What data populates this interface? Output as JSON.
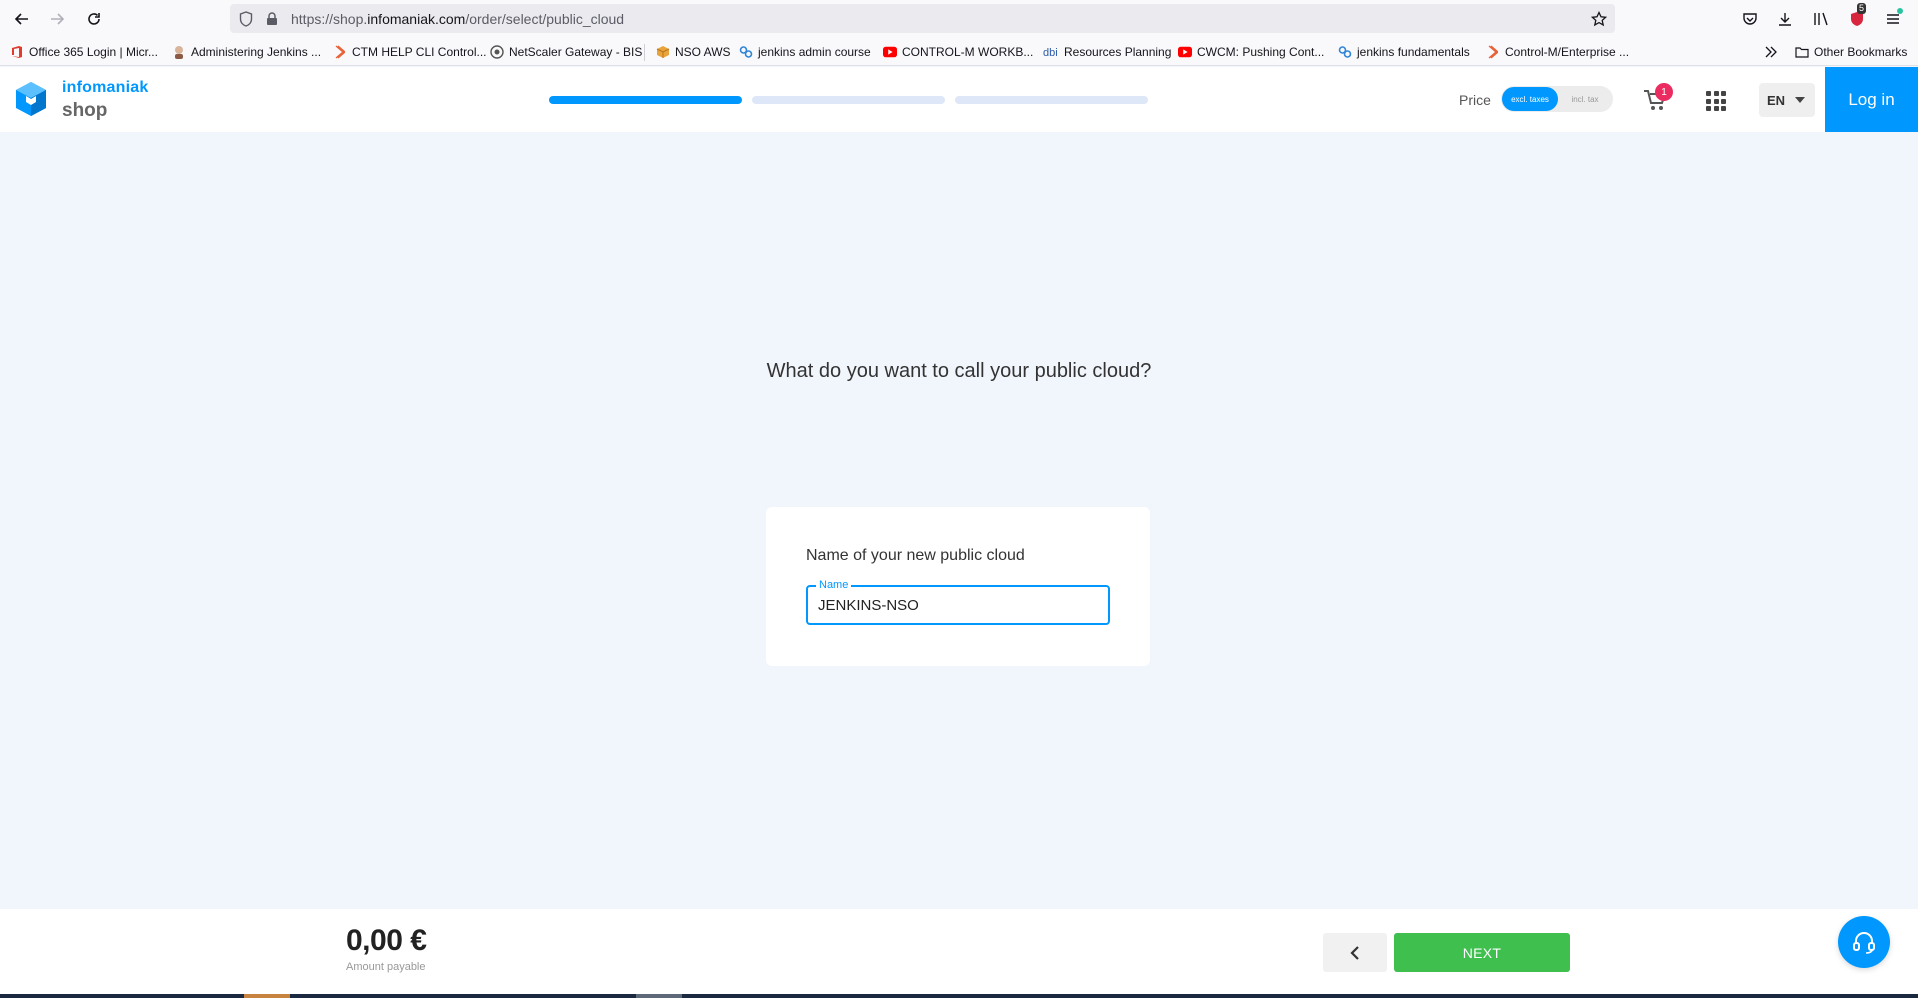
{
  "browser": {
    "url_prefix": "https://shop.",
    "url_domain": "infomaniak.com",
    "url_path": "/order/select/public_cloud",
    "extensions_badge": "5"
  },
  "bookmarks": [
    {
      "label": "Office 365 Login | Micr...",
      "icon": "office-icon",
      "color": "#e23b2e"
    },
    {
      "label": "Administering Jenkins ...",
      "icon": "jenkins-icon",
      "color": "#8a5a44"
    },
    {
      "label": "CTM HELP CLI Control...",
      "icon": "bmc-icon",
      "color": "#e8623a"
    },
    {
      "label": "NetScaler Gateway - BIS",
      "icon": "netscaler-icon",
      "color": "#555555"
    },
    {
      "label": "NSO AWS",
      "icon": "aws-box-icon",
      "color": "#e8a33a"
    },
    {
      "label": "jenkins admin course",
      "icon": "link-icon",
      "color": "#2f86d8"
    },
    {
      "label": "CONTROL-M WORKB...",
      "icon": "youtube-icon",
      "color": "#ff0000"
    },
    {
      "label": "Resources Planning",
      "icon": "dbi-icon",
      "color": "#2d5aa8"
    },
    {
      "label": "CWCM: Pushing Cont...",
      "icon": "youtube-icon",
      "color": "#ff0000"
    },
    {
      "label": "jenkins fundamentals",
      "icon": "link-icon",
      "color": "#2f86d8"
    },
    {
      "label": "Control-M/Enterprise ...",
      "icon": "bmc-icon",
      "color": "#e8623a"
    }
  ],
  "other_bookmarks": "Other Bookmarks",
  "header": {
    "brand": "infomaniak",
    "brand_sub": "shop",
    "steps": [
      {
        "state": "active"
      },
      {
        "state": "inactive"
      },
      {
        "state": "inactive"
      }
    ],
    "price_label": "Price",
    "price_excl": "excl. taxes",
    "price_incl": "incl. tax",
    "cart_count": "1",
    "language": "EN",
    "login_label": "Log in",
    "accent_color": "#0098ff"
  },
  "main": {
    "question": "What do you want to call your public cloud?",
    "card_title": "Name of your new public cloud",
    "field_label": "Name",
    "field_value": "JENKINS-NSO"
  },
  "footer": {
    "amount": "0,00 €",
    "amount_label": "Amount payable",
    "next_label": "NEXT",
    "next_color": "#3ebf4e"
  }
}
